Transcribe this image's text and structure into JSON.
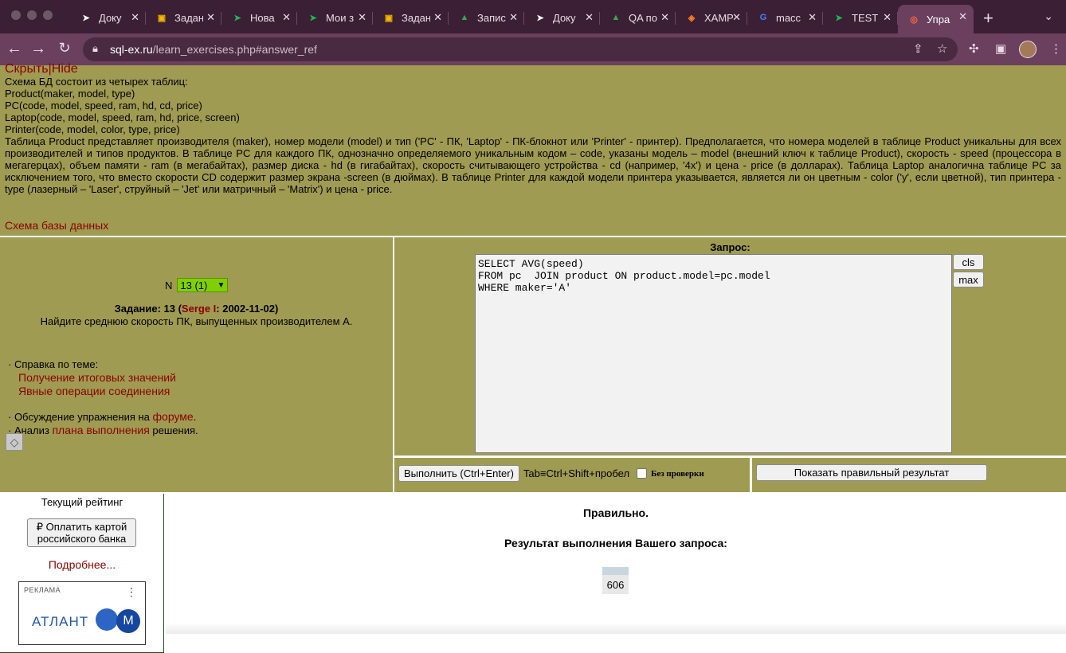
{
  "browser": {
    "tabs": [
      {
        "label": "Доку",
        "icon": "paper-plane-icon",
        "icon_color": "#ffffff"
      },
      {
        "label": "Задан",
        "icon": "classroom-icon",
        "icon_color": "#f5b800"
      },
      {
        "label": "Нова",
        "icon": "paper-plane-icon",
        "icon_color": "#1db954"
      },
      {
        "label": "Мои з",
        "icon": "paper-plane-icon",
        "icon_color": "#1db954"
      },
      {
        "label": "Задан",
        "icon": "classroom-icon",
        "icon_color": "#f5b800"
      },
      {
        "label": "Запис",
        "icon": "drive-icon",
        "icon_color": "#34a853"
      },
      {
        "label": "Доку",
        "icon": "paper-plane-icon",
        "icon_color": "#ffffff"
      },
      {
        "label": "QA по",
        "icon": "drive-icon",
        "icon_color": "#34a853"
      },
      {
        "label": "XAMP",
        "icon": "xampp-icon",
        "icon_color": "#fb7a24"
      },
      {
        "label": "macc",
        "icon": "google-icon",
        "icon_color": "#4285f4"
      },
      {
        "label": "TEST",
        "icon": "paper-plane-icon",
        "icon_color": "#1db954"
      },
      {
        "label": "Упра",
        "icon": "target-icon",
        "icon_color": "#ff6a3d",
        "active": true
      }
    ],
    "url_host": "sql-ex.ru",
    "url_path": "/learn_exercises.php#answer_ref"
  },
  "schema": {
    "hide_link": "Скрыть|Hide",
    "lines": [
      "Схема БД состоит из четырех таблиц:",
      "Product(maker, model, type)",
      "PC(code, model, speed, ram, hd, cd, price)",
      "Laptop(code, model, speed, ram, hd, price, screen)",
      "Printer(code, model, color, type, price)"
    ],
    "description": "Таблица Product представляет производителя (maker), номер модели (model) и тип ('PC' - ПК, 'Laptop' - ПК-блокнот или 'Printer' - принтер). Предполагается, что номера моделей в таблице Product уникальны для всех производителей и типов продуктов. В таблице PC для каждого ПК, однозначно определяемого уникальным кодом – code, указаны модель – model (внешний ключ к таблице Product), скорость - speed (процессора в мегагерцах), объем памяти - ram (в мегабайтах), размер диска - hd (в гигабайтах), скорость считывающего устройства - cd (например, '4x') и цена - price (в долларах). Таблица Laptop аналогична таблице PC за исключением того, что вместо скорости CD содержит размер экрана -screen (в дюймах). В таблице Printer для каждой модели принтера указывается, является ли он цветным - color ('y', если цветной), тип принтера - type (лазерный – 'Laser', струйный – 'Jet' или матричный – 'Matrix') и цена - price.",
    "diagram_link": "Схема базы данных"
  },
  "task": {
    "n_label": "N",
    "n_selected": "13 (1)",
    "title_prefix": "Задание: 13 (",
    "author": "Serge I",
    "title_suffix": ": 2002-11-02)",
    "text": "Найдите среднюю скорость ПК, выпущенных производителем A.",
    "help_label": "· Справка по теме:",
    "help_links": [
      "Получение итоговых значений",
      "Явные операции соединения"
    ],
    "forum_prefix": "· Обсуждение упражнения на ",
    "forum_link": "форуме",
    "forum_suffix": ".",
    "plan_prefix": "· Анализ ",
    "plan_link": "плана выполнения",
    "plan_suffix": " решения."
  },
  "query": {
    "label": "Запрос:",
    "text": "SELECT AVG(speed)\nFROM pc  JOIN product ON product.model=pc.model\nWHERE maker='A'",
    "cls_label": "cls",
    "max_label": "max",
    "execute_label": "Выполнить (Ctrl+Enter)",
    "tab_hint": "Tab≡Ctrl+Shift+пробел",
    "no_check_label": "Без проверки",
    "show_result_label": "Показать правильный результат"
  },
  "sidebar": {
    "rating_title": "Текущий рейтинг",
    "pay_label": "₽ Оплатить картой российского банка",
    "more_link": "Подробнее...",
    "ad_label": "РЕКЛАМА",
    "ad_brand": "АТЛАНТ",
    "ad_brand_m": "M"
  },
  "result": {
    "status": "Правильно.",
    "title": "Результат выполнения Вашего запроса:",
    "value": "606"
  }
}
